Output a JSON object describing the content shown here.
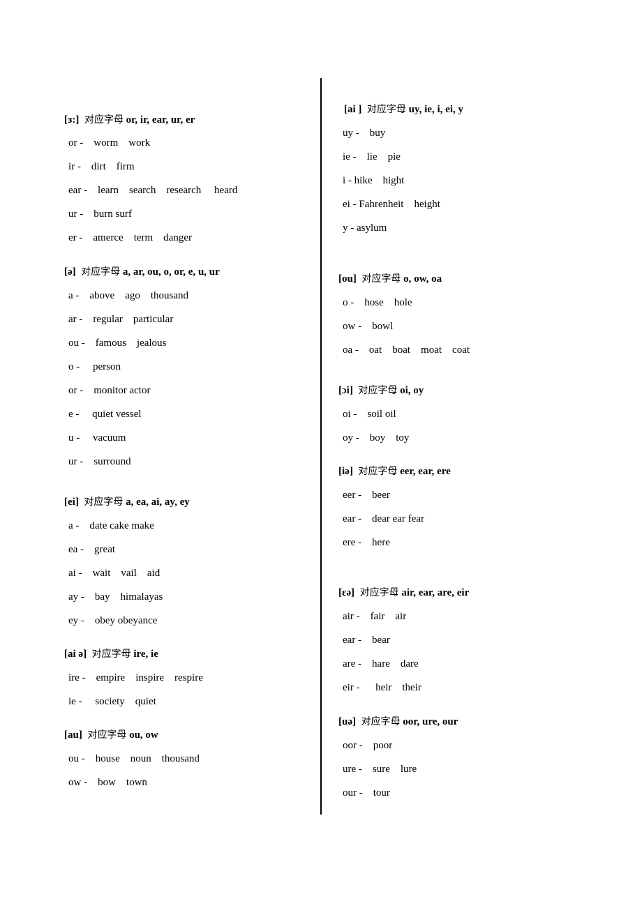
{
  "cn_label": "对应字母",
  "left_sections": [
    {
      "symbol": "[ɜ:]",
      "letters": "or, ir, ear, ur, er",
      "rows": [
        "or -    worm    work",
        "ir -    dirt    firm",
        "ear -    learn    search    research     heard",
        "ur -    burn surf",
        "er -    amerce    term    danger"
      ]
    },
    {
      "symbol": "[ə]",
      "letters": "a, ar, ou, o, or, e, u, ur",
      "rows": [
        "a -    above    ago    thousand",
        "ar -    regular    particular",
        "ou -    famous    jealous",
        "o -     person",
        "or -    monitor actor",
        "e -     quiet vessel",
        "u -     vacuum",
        "ur -    surround"
      ]
    },
    {
      "symbol": "[ei]",
      "letters": "a, ea, ai, ay, ey",
      "rows": [
        "a -    date cake make",
        "ea -    great",
        "ai -    wait    vail    aid",
        "ay -    bay    himalayas",
        "ey -    obey obeyance"
      ]
    },
    {
      "symbol": "[ai ə]",
      "letters": "ire, ie",
      "rows": [
        "ire -    empire    inspire    respire",
        "ie -     society    quiet"
      ]
    },
    {
      "symbol": "[au]",
      "letters": "ou, ow",
      "rows": [
        "ou -    house    noun    thousand",
        "ow -    bow    town"
      ]
    }
  ],
  "right_sections": [
    {
      "symbol": "[ai ]",
      "letters": "uy, ie, i, ei, y",
      "rows": [
        "uy -    buy",
        "ie -    lie    pie",
        "i - hike    hight",
        "ei - Fahrenheit    height",
        "y - asylum"
      ]
    },
    {
      "symbol": "[ou]",
      "letters": "o, ow, oa",
      "rows": [
        "o -    hose    hole",
        "ow -    bowl",
        "oa -    oat    boat    moat    coat"
      ]
    },
    {
      "symbol": "[ɔi]",
      "letters": "oi, oy",
      "rows": [
        "oi -    soil oil",
        "oy -    boy    toy"
      ]
    },
    {
      "symbol": "[iə]",
      "letters": "eer, ear, ere",
      "rows": [
        "eer -    beer",
        "ear -    dear ear fear",
        "ere -    here"
      ]
    },
    {
      "symbol": "[ɛə]",
      "letters": "air, ear, are, eir",
      "rows": [
        "air -    fair    air",
        "ear -    bear",
        "are -    hare    dare",
        "eir -      heir    their"
      ]
    },
    {
      "symbol": "[uə]",
      "letters": "oor, ure, our",
      "rows": [
        "oor -    poor",
        "ure -    sure    lure",
        "our -    tour"
      ]
    }
  ]
}
